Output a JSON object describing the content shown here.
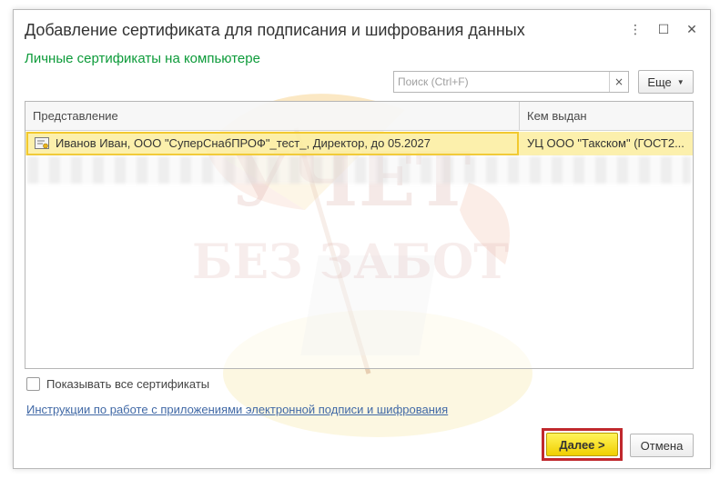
{
  "window": {
    "title": "Добавление сертификата для подписания и шифрования данных",
    "controls": {
      "more_icon": "⋮",
      "maximize_icon": "☐",
      "close_icon": "✕"
    }
  },
  "section_title": "Личные сертификаты на компьютере",
  "search": {
    "placeholder": "Поиск (Ctrl+F)",
    "value": "",
    "clear_icon": "×"
  },
  "more_button": {
    "label": "Еще",
    "arrow": "▼"
  },
  "table": {
    "columns": [
      "Представление",
      "Кем выдан"
    ],
    "rows": [
      {
        "representation": "Иванов Иван, ООО \"СуперСнабПРОФ\"_тест_, Директор, до 05.2027",
        "issuer": "УЦ ООО \"Такском\" (ГОСТ2...",
        "selected": true
      }
    ]
  },
  "show_all_checkbox": {
    "label": "Показывать все сертификаты",
    "checked": false
  },
  "instructions_link": "Инструкции по работе с приложениями электронной подписи и шифрования",
  "buttons": {
    "next": "Далее >",
    "cancel": "Отмена"
  },
  "watermark": {
    "line1": "УЧЕТ",
    "line2": "БЕЗ ЗАБОТ"
  },
  "colors": {
    "accent_green": "#0d9b3a",
    "selected_row": "#fbed9e",
    "primary_button": "#f7e21c",
    "highlight_frame": "#c0282d",
    "link": "#4169a6"
  }
}
